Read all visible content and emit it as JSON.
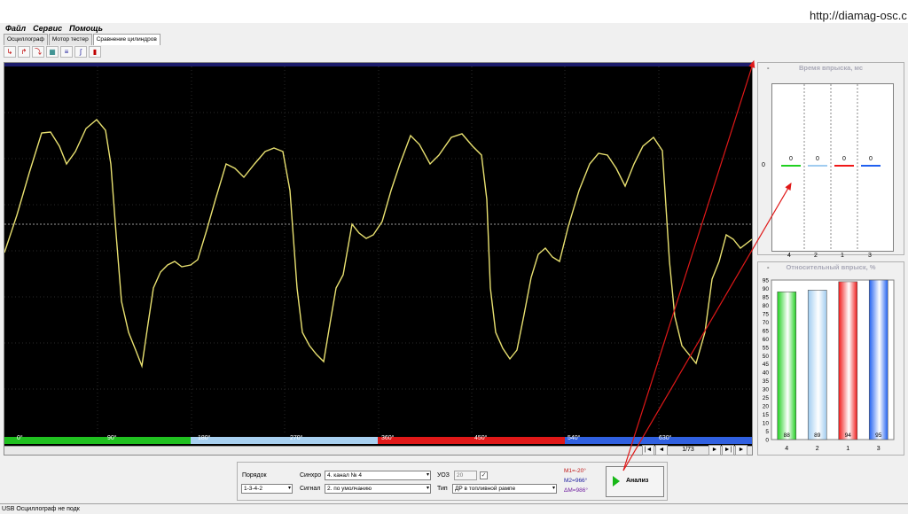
{
  "watermark": "http://diamag-osc.c",
  "menu": [
    "Файл",
    "Сервис",
    "Помощь"
  ],
  "tabs": [
    {
      "label": "Осциллограф",
      "active": false
    },
    {
      "label": "Мотор тестер",
      "active": false
    },
    {
      "label": "Сравнение цилиндров",
      "active": true
    }
  ],
  "toolbar_icons": [
    "cursor-add-icon",
    "cursor-step-icon",
    "cursor-remove-icon",
    "channels-icon",
    "list-icon",
    "waveform-icon",
    "record-icon"
  ],
  "scope": {
    "degree_labels": [
      "0°",
      "90°",
      "180°",
      "270°",
      "360°",
      "450°",
      "540°",
      "630°"
    ],
    "cylinder_colors": [
      "#20c020",
      "#a8d0f0",
      "#e01818",
      "#3060e0"
    ],
    "trace_color": "#e8e070"
  },
  "navigation": {
    "first": "|◄",
    "prev": "◄",
    "page": "1/73",
    "next": "►",
    "next_alt": "►|",
    "last": "►"
  },
  "injection_time": {
    "title": "Время впрыска, мс",
    "collapse": "-",
    "axis_zero": "0",
    "cylinders": [
      "4",
      "2",
      "1",
      "3"
    ],
    "values": [
      "0",
      "0",
      "0",
      "0"
    ]
  },
  "relative_injection": {
    "title": "Относительный впрыск, %",
    "collapse": "-",
    "y_ticks": [
      "95",
      "90",
      "85",
      "80",
      "75",
      "70",
      "65",
      "60",
      "55",
      "50",
      "45",
      "40",
      "35",
      "30",
      "25",
      "20",
      "15",
      "10",
      "5",
      "0"
    ],
    "cylinders": [
      "4",
      "2",
      "1",
      "3"
    ],
    "values": [
      88,
      89,
      94,
      95
    ],
    "value_labels": [
      "88",
      "89",
      "94",
      "95"
    ],
    "colors": [
      "#20d020",
      "#a0ccf0",
      "#f01818",
      "#2060f0"
    ]
  },
  "controls": {
    "order_label": "Порядок",
    "order_value": "1-3-4-2",
    "sync_label": "Синхро",
    "sync_value": "4.  канал № 4",
    "signal_label": "Сигнал",
    "signal_value": "2. по умолчанию",
    "uoz_label": "УОЗ",
    "uoz_value": "20",
    "type_label": "Тип",
    "type_value": "ДР в топливной рампе",
    "m1": "M1=-20°",
    "m2": "M2=966°",
    "dm": "ΔM=986°",
    "analyze_label": "Анализ"
  },
  "status": {
    "text": "USB Осциллограф не подк"
  }
}
